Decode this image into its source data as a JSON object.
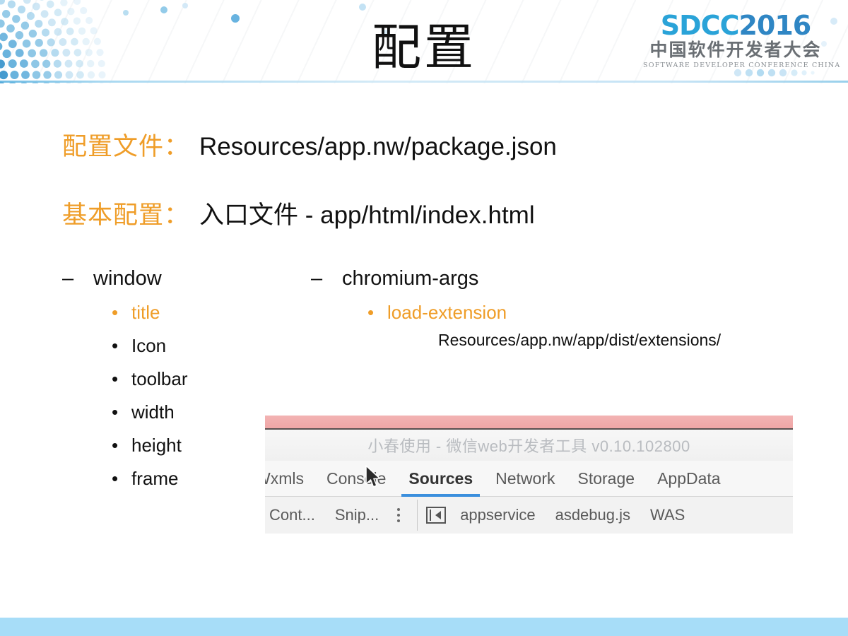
{
  "slide": {
    "title": "配置",
    "accent_color": "#ef9d28",
    "brand_color": "#2aa3d8",
    "footer_color": "#a7ddf8"
  },
  "logo": {
    "main": "SDCC",
    "year": "2016",
    "chinese": "中国软件开发者大会",
    "english": "SOFTWARE DEVELOPER CONFERENCE CHINA"
  },
  "rows": [
    {
      "key": "配置文件：",
      "value": "Resources/app.nw/package.json"
    },
    {
      "key": "基本配置：",
      "value": "入口文件 - app/html/index.html"
    }
  ],
  "columns": {
    "window": {
      "dash": "–",
      "heading": "window",
      "bullet": "•",
      "items": [
        {
          "label": "title",
          "accent": true
        },
        {
          "label": "Icon",
          "accent": false
        },
        {
          "label": "toolbar",
          "accent": false
        },
        {
          "label": "width",
          "accent": false
        },
        {
          "label": "height",
          "accent": false
        },
        {
          "label": "frame",
          "accent": false
        }
      ]
    },
    "chromium": {
      "dash": "–",
      "heading": "chromium-args",
      "bullet": "•",
      "items": [
        {
          "label": "load-extension",
          "accent": true
        }
      ],
      "detail": "Resources/app.nw/app/dist/extensions/"
    }
  },
  "screenshot": {
    "title": "小春使用 - 微信web开发者工具 v0.10.102800",
    "tabs": [
      {
        "label": "Wxmls",
        "active": false
      },
      {
        "label": "Console",
        "active": false
      },
      {
        "label": "Sources",
        "active": true
      },
      {
        "label": "Network",
        "active": false
      },
      {
        "label": "Storage",
        "active": false
      },
      {
        "label": "AppData",
        "active": false
      }
    ],
    "subbar": {
      "left_items": [
        "Cont...",
        "Snip..."
      ],
      "files": [
        "appservice",
        "asdebug.js",
        "WAS"
      ]
    }
  }
}
